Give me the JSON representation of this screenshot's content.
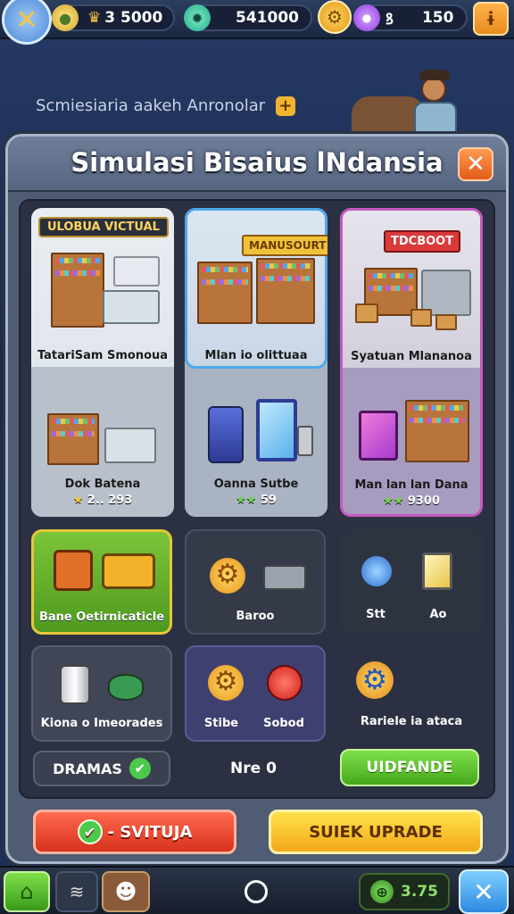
{
  "topbar": {
    "currency1": "3 5000",
    "currency2": "541000",
    "currency3": "150",
    "currency3_icon_symbol": "ꝸ"
  },
  "background": {
    "notice": "Scmiesiaria aakeh Anronolar"
  },
  "modal": {
    "title": "Simulasi Bisaius lNdansia"
  },
  "cards": {
    "c1": {
      "badge": "ULOBUA VICTUAL",
      "label": "TatariSam Smonoua"
    },
    "c2": {
      "sign": "MANUSOURT",
      "label": "Mlan io olittuaa"
    },
    "c3": {
      "sign": "TDCBOOT",
      "label": "Syatuan Mlananoa"
    },
    "c4": {
      "label": "Dok Batena",
      "stat": "2.. 293"
    },
    "c5": {
      "label": "Oanna Sutbe",
      "stat": "59"
    },
    "c6": {
      "label": "Man lan lan Dana",
      "stat": "9300"
    }
  },
  "row2": {
    "r1": {
      "label": "Bane Oetirnicaticle"
    },
    "r2": {
      "label": "Baroo"
    },
    "r3a": {
      "label": "Stt"
    },
    "r3b": {
      "label": "Ao"
    }
  },
  "row3": {
    "r1": {
      "label": "Kiona o Imeorades"
    },
    "r2a": {
      "label": "Stibe"
    },
    "r2b": {
      "label": "Sobod"
    },
    "r3": {
      "label": "Rariele ia ataca"
    }
  },
  "footer_row": {
    "dramas": "DRAMAS",
    "count": "Nre 0",
    "upgrade": "UIDFANDE"
  },
  "actions": {
    "left": "- SVITUJA",
    "right": "SUIEK UPRADE"
  },
  "bottom": {
    "counter": "3.75"
  }
}
